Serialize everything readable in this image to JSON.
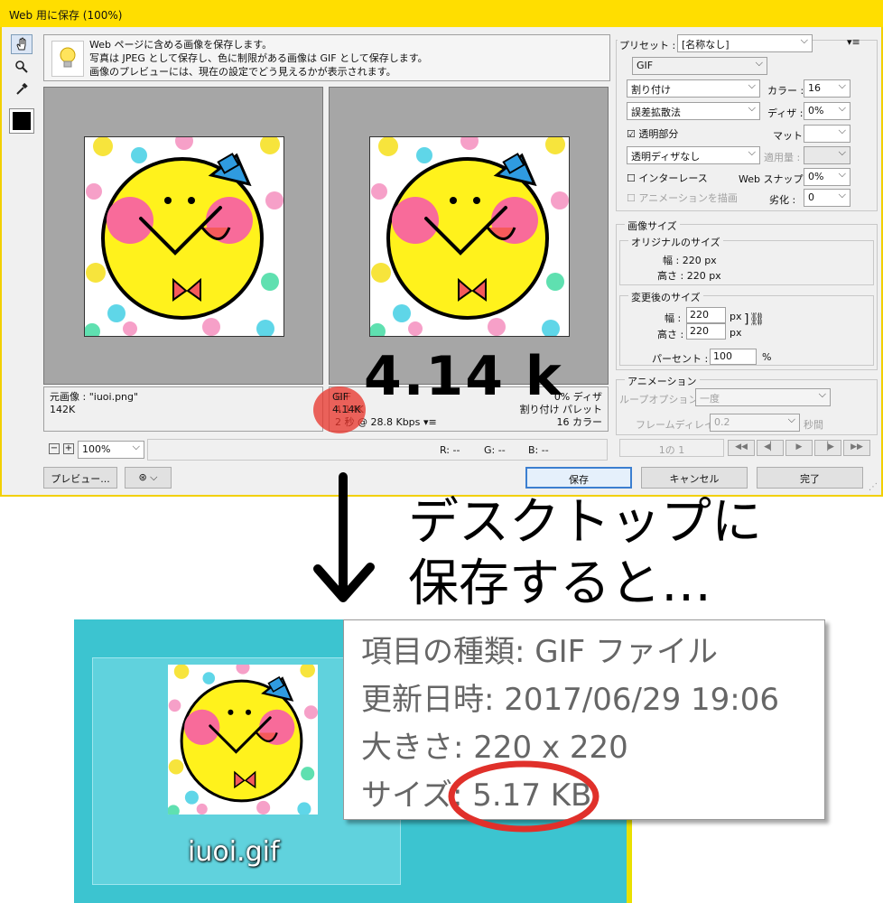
{
  "dialog": {
    "title": "Web 用に保存 (100%)",
    "info_lines": [
      "Web ページに含める画像を保存します。",
      "写真は JPEG として保存し、色に制限がある画像は GIF として保存します。",
      "画像のプレビューには、現在の設定でどう見えるかが表示されます。"
    ]
  },
  "original": {
    "name": "元画像 : \"iuoi.png\"",
    "size": "142K"
  },
  "optimized": {
    "format": "GIF",
    "size": "4.14K",
    "time": "2 秒 @ 28.8 Kbps",
    "dither": "0% ディザ",
    "palette": "割り付け パレット",
    "colors": "16 カラー"
  },
  "zoom": "100%",
  "rgb": {
    "r": "R: --",
    "g": "G: --",
    "b": "B: --"
  },
  "buttons": {
    "preview": "プレビュー...",
    "save": "保存",
    "cancel": "キャンセル",
    "done": "完了"
  },
  "settings": {
    "preset_label": "プリセット :",
    "preset_value": "[名称なし]",
    "format": "GIF",
    "reduction": "割り付け",
    "colors_label": "カラー :",
    "colors_value": "16",
    "dither_algo": "誤差拡散法",
    "dither_label": "ディザ :",
    "dither_value": "0%",
    "transparency": "透明部分",
    "matte_label": "マット :",
    "trans_dither": "透明ディザなし",
    "amount_label": "適用量 :",
    "interlace": "インターレース",
    "websnap_label": "Web スナップ :",
    "websnap_value": "0%",
    "anim_draw": "アニメーションを描画",
    "lossy_label": "劣化 :",
    "lossy_value": "0"
  },
  "image_size": {
    "group": "画像サイズ",
    "original_group": "オリジナルのサイズ",
    "orig_w": "幅 : 220 px",
    "orig_h": "高さ : 220 px",
    "new_group": "変更後のサイズ",
    "w_label": "幅 :",
    "w_value": "220",
    "h_label": "高さ :",
    "h_value": "220",
    "unit": "px",
    "percent_label": "パーセント :",
    "percent_value": "100",
    "percent_unit": "%"
  },
  "animation": {
    "group": "アニメーション",
    "loop_label": "ループオプション :",
    "loop_value": "一度",
    "delay_label": "フレームディレイ :",
    "delay_value": "0.2",
    "delay_unit": "秒間",
    "counter": "1の 1"
  },
  "annotations": {
    "size_big": "4.14 k",
    "caption_line1": "デスクトップに",
    "caption_line2": "保存すると…"
  },
  "desktop": {
    "filename": "iuoi.gif"
  },
  "tooltip": {
    "type": "項目の種類: GIF ファイル",
    "modified": "更新日時: 2017/06/29 19:06",
    "dimensions": "大きさ: 220 x 220",
    "size": "サイズ: 5.17 KB"
  },
  "colors": {
    "accent": "#ffde00",
    "annotation_red": "#e0302a",
    "desktop_bg": "#3cc4d0"
  }
}
